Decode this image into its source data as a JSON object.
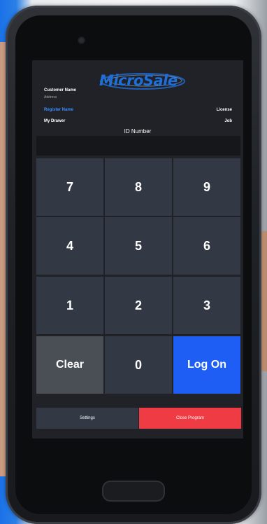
{
  "app": {
    "logo": "MicroSale"
  },
  "header": {
    "customer_name": "Customer Name",
    "address": "Address",
    "register_name": "Register Name",
    "license": "License",
    "my_drawer": "My Drawer",
    "job": "Job"
  },
  "login": {
    "id_label": "ID Number",
    "id_value": "",
    "keys": [
      "7",
      "8",
      "9",
      "4",
      "5",
      "6",
      "1",
      "2",
      "3"
    ],
    "clear_label": "Clear",
    "zero_label": "0",
    "logon_label": "Log On"
  },
  "footer": {
    "settings_label": "Settings",
    "close_label": "Close Program"
  },
  "colors": {
    "accent": "#1e5ef5",
    "danger": "#ef3b44",
    "key_bg": "#323844",
    "screen_bg": "#202227"
  }
}
